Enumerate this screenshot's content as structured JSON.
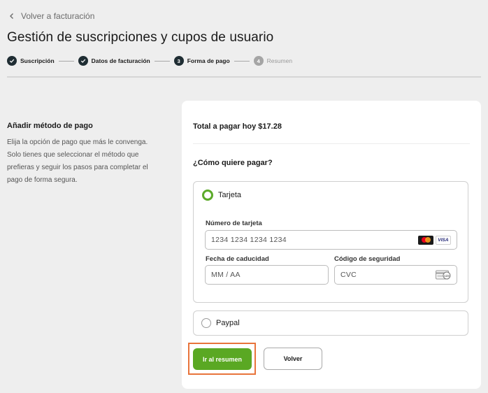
{
  "nav": {
    "back_label": "Volver a facturación"
  },
  "page": {
    "title": "Gestión de suscripciones y cupos de usuario"
  },
  "stepper": {
    "steps": [
      {
        "label": "Suscripción",
        "state": "done",
        "number": ""
      },
      {
        "label": "Datos de facturación",
        "state": "done",
        "number": ""
      },
      {
        "label": "Forma de pago",
        "state": "current",
        "number": "3"
      },
      {
        "label": "Resumen",
        "state": "pending",
        "number": "4"
      }
    ]
  },
  "intro": {
    "title": "Añadir método de pago",
    "lines": [
      "Elija la opción de pago que más le convenga.",
      "Solo tienes que seleccionar el método que",
      "prefieras y seguir los pasos para completar el",
      "pago de forma segura."
    ]
  },
  "payment": {
    "total": "Total a pagar hoy $17.28",
    "question": "¿Cómo quiere pagar?",
    "card_option": {
      "label": "Tarjeta",
      "selected": true,
      "number_label": "Número de tarjeta",
      "number_placeholder": "1234 1234 1234 1234",
      "card_brands": [
        "mastercard-icon",
        "visa-icon"
      ],
      "visa_text": "VISA",
      "expiry_label": "Fecha de caducidad",
      "expiry_placeholder": "MM / AA",
      "cvc_label": "Código de seguridad",
      "cvc_placeholder": "CVC",
      "cvc_badge": "123"
    },
    "paypal_option": {
      "label": "Paypal",
      "selected": false
    }
  },
  "actions": {
    "primary_label": "Ir al resumen",
    "secondary_label": "Volver"
  },
  "colors": {
    "accent_green": "#5aa823",
    "highlight_orange": "#e8743b",
    "step_dark": "#1f2d33",
    "background": "#eeeeee"
  }
}
